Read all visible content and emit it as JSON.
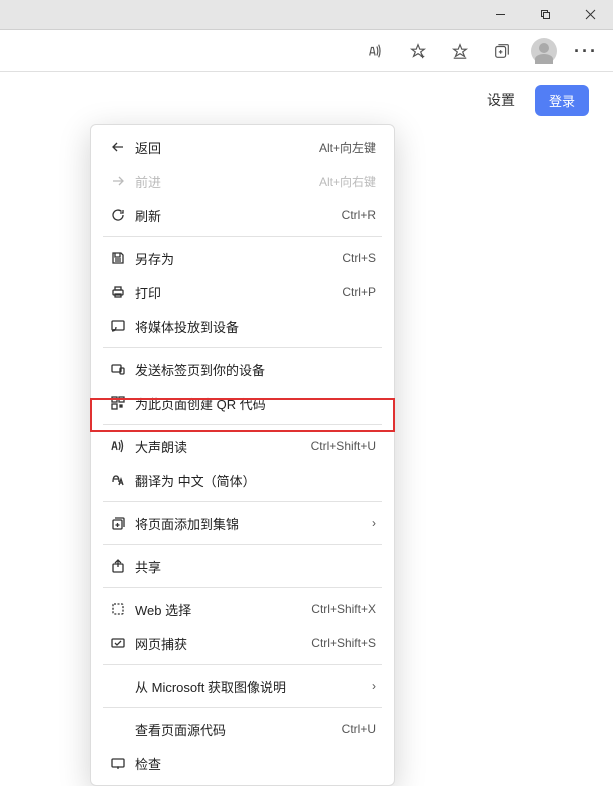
{
  "titlebar": {},
  "header": {
    "settings_label": "设置",
    "login_label": "登录"
  },
  "menu": {
    "back": {
      "label": "返回",
      "shortcut": "Alt+向左键"
    },
    "forward": {
      "label": "前进",
      "shortcut": "Alt+向右键"
    },
    "refresh": {
      "label": "刷新",
      "shortcut": "Ctrl+R"
    },
    "saveas": {
      "label": "另存为",
      "shortcut": "Ctrl+S"
    },
    "print": {
      "label": "打印",
      "shortcut": "Ctrl+P"
    },
    "cast": {
      "label": "将媒体投放到设备"
    },
    "sendtab": {
      "label": "发送标签页到你的设备"
    },
    "qr": {
      "label": "为此页面创建 QR 代码"
    },
    "readaloud": {
      "label": "大声朗读",
      "shortcut": "Ctrl+Shift+U"
    },
    "translate": {
      "label": "翻译为 中文（简体）"
    },
    "addcollection": {
      "label": "将页面添加到集锦"
    },
    "share": {
      "label": "共享"
    },
    "webselect": {
      "label": "Web 选择",
      "shortcut": "Ctrl+Shift+X"
    },
    "webcapture": {
      "label": "网页捕获",
      "shortcut": "Ctrl+Shift+S"
    },
    "msimg": {
      "label": "从 Microsoft 获取图像说明"
    },
    "viewsource": {
      "label": "查看页面源代码",
      "shortcut": "Ctrl+U"
    },
    "inspect": {
      "label": "检查"
    }
  }
}
